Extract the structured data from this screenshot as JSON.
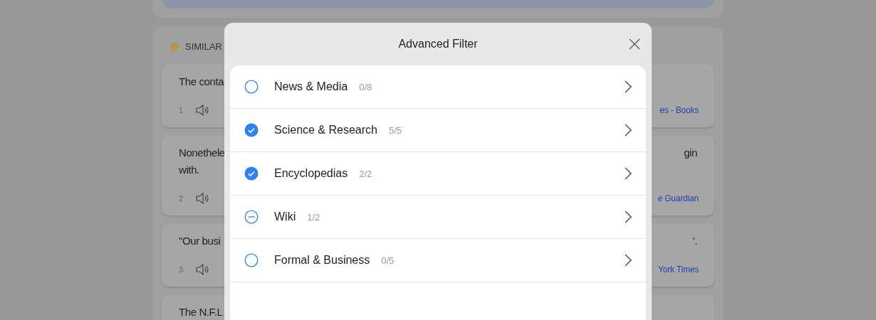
{
  "background": {
    "section_label": "SIMILAR",
    "cards": [
      {
        "number": "1",
        "lines": [
          "The conta"
        ],
        "source": "es - Books"
      },
      {
        "number": "2",
        "lines": [
          "Nonethele",
          "with."
        ],
        "right_lines": [
          "gin"
        ],
        "source": "e Guardian"
      },
      {
        "number": "3",
        "lines": [
          "\"Our busi"
        ],
        "right_lines": [
          "'."
        ],
        "source": "York Times"
      },
      {
        "lines": [
          "The N.F.L"
        ]
      }
    ]
  },
  "dialog": {
    "title": "Advanced Filter",
    "categories": [
      {
        "label": "News & Media",
        "count": "0/8",
        "checked": false,
        "partial": false
      },
      {
        "label": "Science & Research",
        "count": "5/5",
        "checked": true,
        "partial": false
      },
      {
        "label": "Encyclopedias",
        "count": "2/2",
        "checked": true,
        "partial": false
      },
      {
        "label": "Wiki",
        "count": "1/2",
        "checked": false,
        "partial": true
      },
      {
        "label": "Formal & Business",
        "count": "0/5",
        "checked": false,
        "partial": false
      }
    ]
  }
}
